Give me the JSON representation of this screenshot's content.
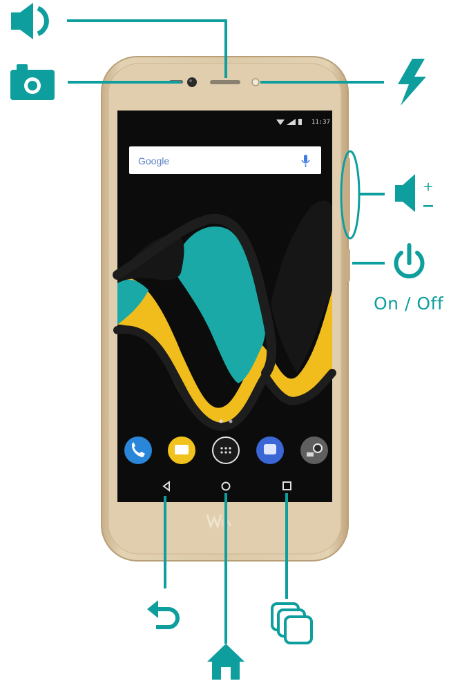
{
  "labels": {
    "power": "On / Off"
  },
  "phone": {
    "status_time": "11:37",
    "search_brand": "Google",
    "brand_logo": "Wiko"
  },
  "colors": {
    "accent": "#0e9e9e",
    "phone_body": "#d9c39f",
    "screen": "#0c0c0c",
    "wave_teal": "#1aa9a6",
    "wave_yellow": "#f1bd1d"
  },
  "icons": [
    "speaker-icon",
    "camera-icon",
    "flash-icon",
    "volume-icon",
    "power-icon",
    "back-icon",
    "home-icon",
    "recent-apps-icon"
  ]
}
